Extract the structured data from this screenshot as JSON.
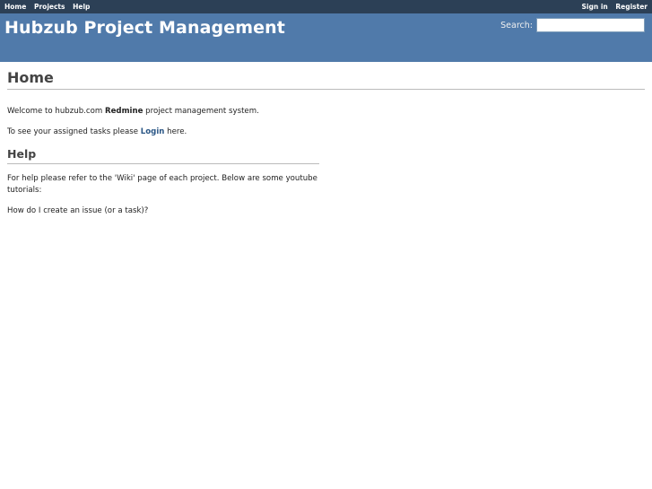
{
  "top_menu": {
    "left": [
      "Home",
      "Projects",
      "Help"
    ],
    "right": [
      "Sign in",
      "Register"
    ]
  },
  "header": {
    "title": "Hubzub Project Management",
    "search_label": "Search:",
    "search_value": ""
  },
  "content": {
    "title": "Home",
    "welcome_prefix": "Welcome to hubzub.com ",
    "welcome_bold": "Redmine",
    "welcome_suffix": " project management system.",
    "tasks_prefix": "To see your assigned tasks please ",
    "tasks_link": "Login",
    "tasks_suffix": " here.",
    "help_title": "Help",
    "help_text": "For help please refer to the 'Wiki' page of each project. Below are some youtube tutorials:",
    "tutorial_question": "How do I create an issue (or a task)?"
  }
}
